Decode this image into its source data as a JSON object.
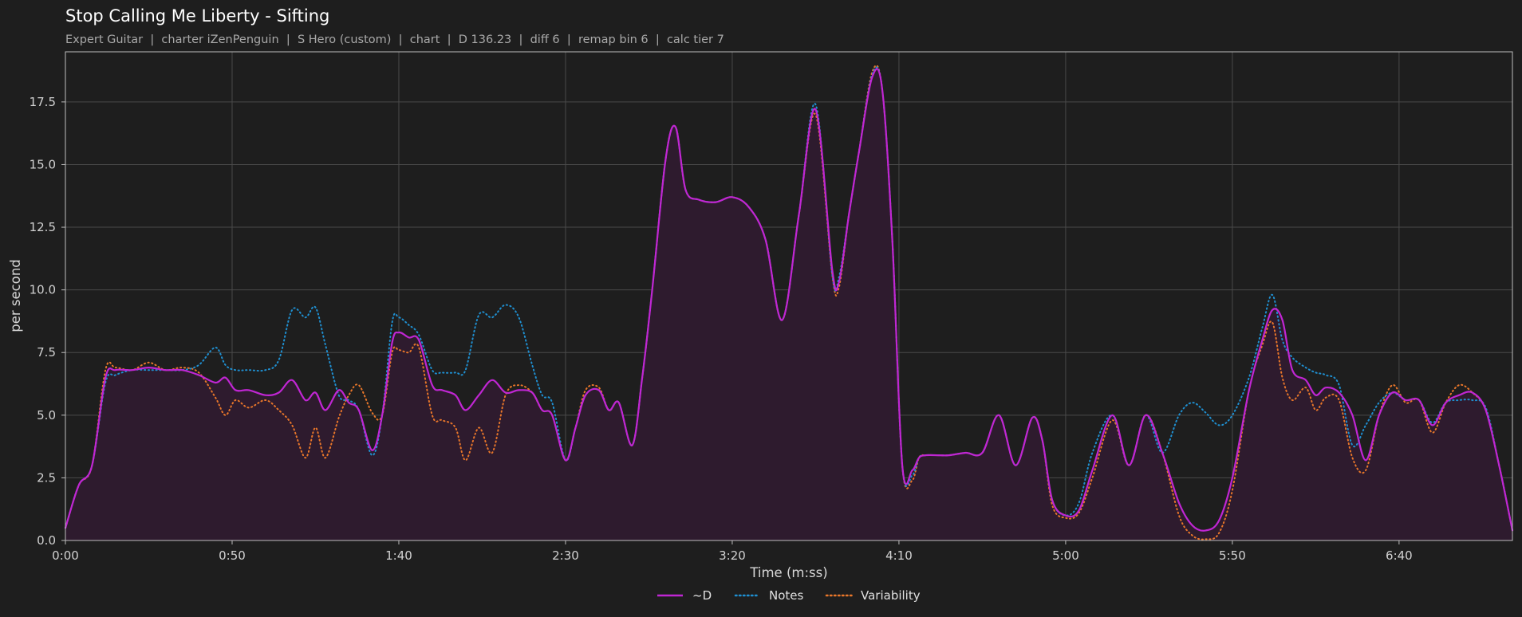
{
  "chart_data": {
    "type": "area",
    "title": "Stop Calling Me Liberty - Sifting",
    "subtitle": "Expert Guitar  |  charter iZenPenguin  |  S Hero (custom)  |  chart  |  D 136.23  |  diff 6  |  remap bin 6  |  calc tier 7",
    "xlabel": "Time (m:ss)",
    "ylabel": "per second",
    "xlim": [
      0,
      434
    ],
    "ylim": [
      0,
      19.5
    ],
    "x_ticks": [
      0,
      50,
      100,
      150,
      200,
      250,
      300,
      350,
      400
    ],
    "x_tick_labels": [
      "0:00",
      "0:50",
      "1:40",
      "2:30",
      "3:20",
      "4:10",
      "5:00",
      "5:50",
      "6:40"
    ],
    "y_ticks": [
      0,
      2.5,
      5,
      7.5,
      10,
      12.5,
      15,
      17.5
    ],
    "y_tick_labels": [
      "0.0",
      "2.5",
      "5.0",
      "7.5",
      "10.0",
      "12.5",
      "15.0",
      "17.5"
    ],
    "grid": true,
    "legend_position": "bottom-center",
    "colors": {
      "d": "#c026d3",
      "notes": "#1f8fd0",
      "variability": "#e8762a",
      "fill": "#2e1b2e",
      "grid": "#4a4a4a",
      "frame": "#bdbdbd",
      "background": "#1e1e1e"
    },
    "series": [
      {
        "name": "~D",
        "style": "solid",
        "x": [
          0,
          4,
          8,
          12,
          15,
          20,
          25,
          30,
          35,
          40,
          45,
          48,
          51,
          55,
          60,
          64,
          68,
          72,
          75,
          78,
          82,
          85,
          88,
          92,
          95,
          98,
          100,
          103,
          106,
          110,
          113,
          117,
          120,
          124,
          128,
          132,
          136,
          140,
          143,
          146,
          150,
          153,
          156,
          160,
          163,
          166,
          170,
          173,
          176,
          180,
          183,
          186,
          190,
          195,
          200,
          205,
          210,
          215,
          220,
          225,
          230,
          232,
          235,
          238,
          242,
          245,
          248,
          251,
          254,
          256,
          258,
          262,
          265,
          270,
          275,
          280,
          285,
          290,
          293,
          296,
          300,
          304,
          308,
          314,
          319,
          324,
          329,
          334,
          338,
          342,
          346,
          350,
          355,
          359,
          362,
          365,
          368,
          372,
          375,
          378,
          382,
          386,
          390,
          394,
          398,
          402,
          406,
          410,
          414,
          418,
          422,
          426,
          430,
          434
        ],
        "values": [
          0.5,
          2.2,
          3.0,
          6.5,
          6.8,
          6.8,
          6.9,
          6.8,
          6.8,
          6.6,
          6.3,
          6.5,
          6.0,
          6.0,
          5.8,
          5.9,
          6.4,
          5.6,
          5.9,
          5.2,
          6.0,
          5.5,
          5.2,
          3.6,
          5.0,
          7.9,
          8.3,
          8.1,
          8.0,
          6.2,
          6.0,
          5.8,
          5.2,
          5.8,
          6.4,
          5.9,
          6.0,
          5.9,
          5.2,
          5.0,
          3.2,
          4.5,
          5.8,
          6.0,
          5.2,
          5.5,
          3.8,
          6.5,
          10.0,
          15.2,
          16.5,
          14.0,
          13.6,
          13.5,
          13.7,
          13.3,
          12.0,
          8.8,
          13.0,
          17.2,
          10.8,
          10.3,
          13.0,
          15.5,
          18.5,
          18.0,
          12.0,
          3.0,
          2.8,
          3.3,
          3.4,
          3.4,
          3.4,
          3.5,
          3.5,
          5.0,
          3.0,
          4.9,
          4.0,
          1.6,
          1.0,
          1.2,
          2.8,
          5.0,
          3.0,
          5.0,
          3.5,
          1.5,
          0.6,
          0.4,
          0.8,
          2.5,
          6.0,
          8.0,
          9.2,
          8.8,
          6.8,
          6.4,
          5.8,
          6.1,
          5.9,
          5.0,
          3.2,
          5.0,
          5.9,
          5.6,
          5.6,
          4.6,
          5.5,
          5.8,
          5.9,
          5.2,
          3.0,
          0.4
        ]
      },
      {
        "name": "Notes",
        "style": "dotted",
        "x": [
          0,
          4,
          8,
          12,
          15,
          20,
          25,
          30,
          35,
          40,
          45,
          48,
          51,
          55,
          60,
          64,
          68,
          72,
          75,
          78,
          82,
          85,
          88,
          92,
          95,
          98,
          100,
          103,
          106,
          110,
          113,
          117,
          120,
          124,
          128,
          132,
          136,
          140,
          143,
          146,
          150,
          153,
          156,
          160,
          163,
          166,
          170,
          173,
          176,
          180,
          183,
          186,
          190,
          195,
          200,
          205,
          210,
          215,
          220,
          225,
          230,
          232,
          235,
          238,
          242,
          245,
          248,
          251,
          254,
          256,
          258,
          262,
          265,
          270,
          275,
          280,
          285,
          290,
          293,
          296,
          300,
          304,
          308,
          314,
          319,
          324,
          329,
          334,
          338,
          342,
          346,
          350,
          355,
          359,
          362,
          365,
          368,
          372,
          375,
          378,
          382,
          386,
          390,
          394,
          398,
          402,
          406,
          410,
          414,
          418,
          422,
          426,
          430,
          434
        ],
        "values": [
          0.5,
          2.2,
          3.0,
          6.3,
          6.6,
          6.8,
          6.8,
          6.8,
          6.8,
          7.0,
          7.7,
          7.0,
          6.8,
          6.8,
          6.8,
          7.2,
          9.2,
          8.9,
          9.3,
          7.8,
          5.8,
          5.6,
          5.2,
          3.4,
          5.0,
          8.7,
          8.9,
          8.6,
          8.2,
          6.8,
          6.7,
          6.7,
          6.8,
          9.0,
          8.9,
          9.4,
          8.9,
          7.0,
          5.8,
          5.5,
          3.2,
          4.5,
          5.8,
          6.0,
          5.2,
          5.5,
          3.8,
          6.5,
          10.0,
          15.2,
          16.5,
          14.0,
          13.6,
          13.5,
          13.7,
          13.3,
          12.0,
          8.8,
          13.0,
          17.4,
          10.6,
          10.5,
          13.0,
          15.5,
          18.6,
          18.0,
          12.0,
          3.0,
          2.6,
          3.3,
          3.4,
          3.4,
          3.4,
          3.5,
          3.5,
          5.0,
          3.0,
          4.9,
          4.0,
          1.6,
          1.0,
          1.5,
          3.5,
          5.0,
          3.0,
          5.0,
          3.5,
          5.0,
          5.5,
          5.1,
          4.6,
          5.0,
          6.5,
          8.5,
          9.8,
          8.0,
          7.3,
          6.9,
          6.7,
          6.6,
          6.2,
          3.8,
          4.6,
          5.5,
          5.9,
          5.6,
          5.6,
          4.7,
          5.5,
          5.6,
          5.6,
          5.3,
          3.0,
          0.4
        ]
      },
      {
        "name": "Variability",
        "style": "dotted",
        "x": [
          0,
          4,
          8,
          12,
          15,
          20,
          25,
          30,
          35,
          40,
          45,
          48,
          51,
          55,
          60,
          64,
          68,
          72,
          75,
          78,
          82,
          85,
          88,
          92,
          95,
          98,
          100,
          103,
          106,
          110,
          113,
          117,
          120,
          124,
          128,
          132,
          136,
          140,
          143,
          146,
          150,
          153,
          156,
          160,
          163,
          166,
          170,
          173,
          176,
          180,
          183,
          186,
          190,
          195,
          200,
          205,
          210,
          215,
          220,
          225,
          230,
          232,
          235,
          238,
          242,
          245,
          248,
          251,
          254,
          256,
          258,
          262,
          265,
          270,
          275,
          280,
          285,
          290,
          293,
          296,
          300,
          304,
          308,
          314,
          319,
          324,
          329,
          334,
          338,
          342,
          346,
          350,
          355,
          359,
          362,
          365,
          368,
          372,
          375,
          378,
          382,
          386,
          390,
          394,
          398,
          402,
          406,
          410,
          414,
          418,
          422,
          426,
          430,
          434
        ],
        "values": [
          0.5,
          2.2,
          3.0,
          6.8,
          6.9,
          6.8,
          7.1,
          6.8,
          6.9,
          6.7,
          5.7,
          5.0,
          5.6,
          5.3,
          5.6,
          5.2,
          4.6,
          3.3,
          4.5,
          3.3,
          4.9,
          5.8,
          6.2,
          5.1,
          5.0,
          7.5,
          7.6,
          7.5,
          7.7,
          5.0,
          4.8,
          4.5,
          3.2,
          4.5,
          3.5,
          5.8,
          6.2,
          5.9,
          5.2,
          5.0,
          3.2,
          4.5,
          6.0,
          6.1,
          5.2,
          5.5,
          3.8,
          6.5,
          10.0,
          15.2,
          16.5,
          14.0,
          13.6,
          13.5,
          13.7,
          13.3,
          12.0,
          8.8,
          13.0,
          17.0,
          10.6,
          10.1,
          13.0,
          15.5,
          18.7,
          18.0,
          12.0,
          3.0,
          2.4,
          3.3,
          3.4,
          3.4,
          3.4,
          3.5,
          3.5,
          5.0,
          3.0,
          4.9,
          4.0,
          1.4,
          0.9,
          1.1,
          2.5,
          4.8,
          3.0,
          5.0,
          3.5,
          1.0,
          0.2,
          0.05,
          0.3,
          2.0,
          6.0,
          7.8,
          8.7,
          6.5,
          5.6,
          6.1,
          5.2,
          5.7,
          5.6,
          3.3,
          2.8,
          5.0,
          6.2,
          5.5,
          5.6,
          4.3,
          5.5,
          6.2,
          5.9,
          5.2,
          3.0,
          0.4
        ]
      }
    ]
  }
}
